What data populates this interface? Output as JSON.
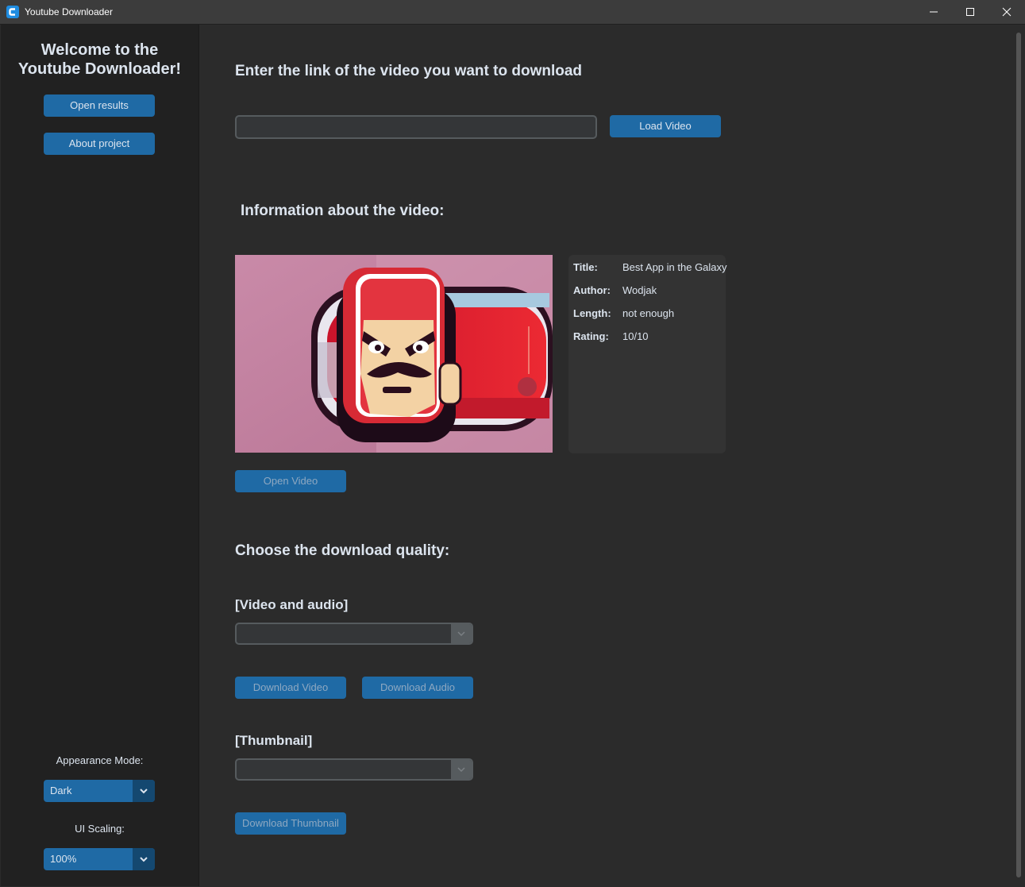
{
  "window": {
    "title": "Youtube Downloader",
    "controls": [
      "minimize-icon",
      "maximize-icon",
      "close-icon"
    ]
  },
  "sidebar": {
    "welcome_line1": "Welcome to the",
    "welcome_line2": "Youtube Downloader!",
    "open_results_label": "Open results",
    "about_label": "About project",
    "appearance_label": "Appearance Mode:",
    "appearance_value": "Dark",
    "scaling_label": "UI Scaling:",
    "scaling_value": "100%"
  },
  "main": {
    "link_heading": "Enter the link of the video you want to download",
    "link_value": "",
    "load_button": "Load Video",
    "info_heading": "Information about the video:",
    "info": [
      {
        "key": "Title:",
        "value": "Best App in the Galaxy"
      },
      {
        "key": "Author:",
        "value": "Wodjak"
      },
      {
        "key": "Length:",
        "value": "not enough"
      },
      {
        "key": "Rating:",
        "value": "10/10"
      }
    ],
    "open_video_button": "Open Video",
    "quality_heading": "Choose the download quality:",
    "video_audio_heading": "[Video and audio]",
    "video_audio_value": "",
    "download_video_button": "Download Video",
    "download_audio_button": "Download Audio",
    "thumbnail_heading": "[Thumbnail]",
    "thumbnail_value": "",
    "download_thumbnail_button": "Download Thumbnail"
  },
  "colors": {
    "background": "#2b2b2b",
    "sidebar": "#212121",
    "accent": "#1f6aa5",
    "accent_dark": "#144870",
    "text": "#dce4ee",
    "entry_bg": "#343638",
    "entry_border": "#565b5e"
  }
}
